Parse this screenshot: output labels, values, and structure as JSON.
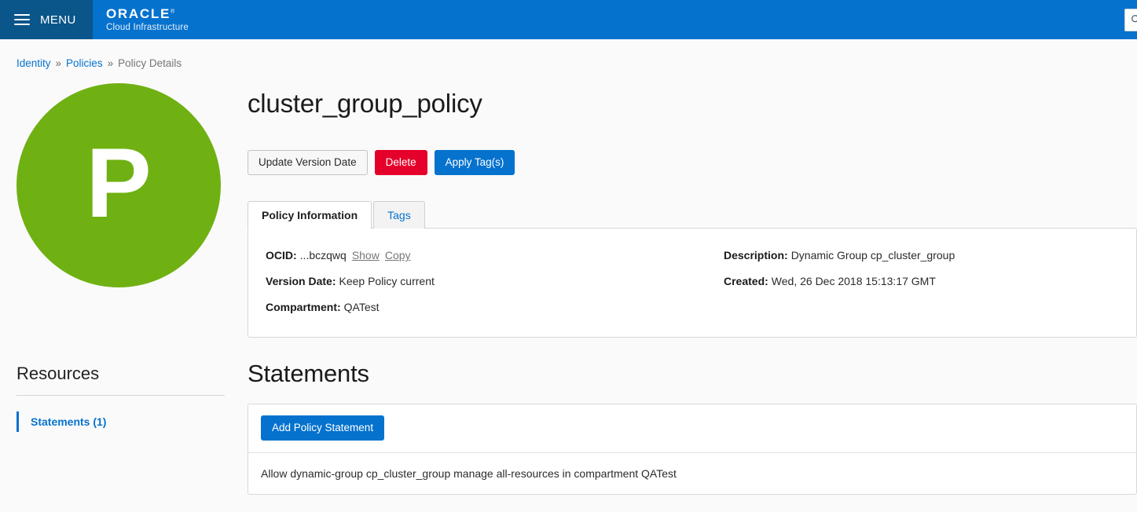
{
  "header": {
    "menu_label": "MENU",
    "hamburger_icon": "hamburger-menu-icon",
    "brand_name": "ORACLE",
    "brand_reg": "®",
    "brand_sub": "Cloud Infrastructure",
    "search_icon": "search-icon",
    "search_placeholder": "",
    "search_value": "",
    "colors": {
      "menu_bg": "#0a5589",
      "bar_bg": "#0572ce"
    }
  },
  "breadcrumb": {
    "items": [
      {
        "label": "Identity",
        "type": "link"
      },
      {
        "label": "Policies",
        "type": "link"
      },
      {
        "label": "Policy Details",
        "type": "current"
      }
    ],
    "separator": "»"
  },
  "avatar": {
    "letter": "P",
    "color": "#6fb112"
  },
  "resources": {
    "title": "Resources",
    "items": [
      {
        "label": "Statements (1)",
        "active": true
      }
    ]
  },
  "main": {
    "title": "cluster_group_policy",
    "actions": [
      {
        "label": "Update Version Date",
        "style": "default"
      },
      {
        "label": "Delete",
        "style": "danger"
      },
      {
        "label": "Apply Tag(s)",
        "style": "primary"
      }
    ],
    "tabs": [
      {
        "label": "Policy Information",
        "active": true
      },
      {
        "label": "Tags",
        "active": false
      }
    ],
    "info": {
      "left": [
        {
          "label": "OCID:",
          "value": "...bczqwq",
          "links": [
            "Show",
            "Copy"
          ]
        },
        {
          "label": "Version Date:",
          "value": "Keep Policy current",
          "links": []
        },
        {
          "label": "Compartment:",
          "value": "QATest",
          "links": []
        }
      ],
      "right": [
        {
          "label": "Description:",
          "value": "Dynamic Group cp_cluster_group",
          "links": []
        },
        {
          "label": "Created:",
          "value": "Wed, 26 Dec 2018 15:13:17 GMT",
          "links": []
        }
      ]
    },
    "statements": {
      "title": "Statements",
      "add_button": "Add Policy Statement",
      "rows": [
        "Allow dynamic-group cp_cluster_group manage all-resources in compartment QATest"
      ]
    }
  }
}
